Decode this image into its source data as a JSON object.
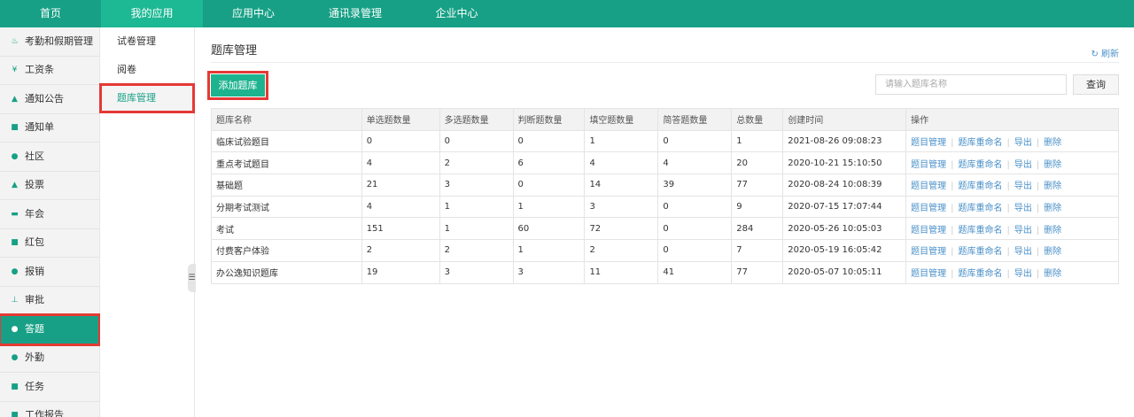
{
  "topnav": [
    {
      "label": "首页",
      "name": "nav-home",
      "active": false
    },
    {
      "label": "我的应用",
      "name": "nav-my-apps",
      "active": true
    },
    {
      "label": "应用中心",
      "name": "nav-app-center",
      "active": false
    },
    {
      "label": "通讯录管理",
      "name": "nav-contacts",
      "active": false
    },
    {
      "label": "企业中心",
      "name": "nav-enterprise",
      "active": false
    }
  ],
  "sidebar": [
    {
      "label": "考勤和假期管理",
      "icon": "attendance-icon",
      "glyph": "♨",
      "name": "sidebar-item-attendance"
    },
    {
      "label": "工资条",
      "icon": "salary-icon",
      "glyph": "¥",
      "name": "sidebar-item-salary"
    },
    {
      "label": "通知公告",
      "icon": "bell-icon",
      "glyph": "▲",
      "name": "sidebar-item-notice"
    },
    {
      "label": "通知单",
      "icon": "document-icon",
      "glyph": "■",
      "name": "sidebar-item-notice-form"
    },
    {
      "label": "社区",
      "icon": "chat-icon",
      "glyph": "●",
      "name": "sidebar-item-community"
    },
    {
      "label": "投票",
      "icon": "vote-icon",
      "glyph": "▲",
      "name": "sidebar-item-vote"
    },
    {
      "label": "年会",
      "icon": "ticket-icon",
      "glyph": "▬",
      "name": "sidebar-item-annual"
    },
    {
      "label": "红包",
      "icon": "red-packet-icon",
      "glyph": "■",
      "name": "sidebar-item-red-packet"
    },
    {
      "label": "报销",
      "icon": "reimburse-icon",
      "glyph": "●",
      "name": "sidebar-item-reimburse"
    },
    {
      "label": "审批",
      "icon": "approval-icon",
      "glyph": "⊥",
      "name": "sidebar-item-approval"
    },
    {
      "label": "答题",
      "icon": "quiz-icon",
      "glyph": "●",
      "name": "sidebar-item-quiz",
      "active": true
    },
    {
      "label": "外勤",
      "icon": "location-icon",
      "glyph": "●",
      "name": "sidebar-item-field"
    },
    {
      "label": "任务",
      "icon": "task-icon",
      "glyph": "■",
      "name": "sidebar-item-task"
    },
    {
      "label": "工作报告",
      "icon": "report-icon",
      "glyph": "■",
      "name": "sidebar-item-report"
    }
  ],
  "subnav": [
    {
      "label": "试卷管理",
      "name": "subnav-exam-papers"
    },
    {
      "label": "阅卷",
      "name": "subnav-grading"
    },
    {
      "label": "题库管理",
      "name": "subnav-question-bank",
      "active": true
    }
  ],
  "main": {
    "title": "题库管理",
    "refresh_label": "刷新",
    "add_label": "添加题库",
    "search_placeholder": "请输入题库名称",
    "search_value": "",
    "search_btn_label": "查询"
  },
  "table": {
    "headers": [
      "题库名称",
      "单选题数量",
      "多选题数量",
      "判断题数量",
      "填空题数量",
      "简答题数量",
      "总数量",
      "创建时间",
      "操作"
    ],
    "actions": [
      "题目管理",
      "题库重命名",
      "导出",
      "删除"
    ],
    "rows": [
      [
        "临床试验题目",
        "0",
        "0",
        "0",
        "1",
        "0",
        "1",
        "2021-08-26 09:08:23"
      ],
      [
        "重点考试题目",
        "4",
        "2",
        "6",
        "4",
        "4",
        "20",
        "2020-10-21 15:10:50"
      ],
      [
        "基础题",
        "21",
        "3",
        "0",
        "14",
        "39",
        "77",
        "2020-08-24 10:08:39"
      ],
      [
        "分期考试测试",
        "4",
        "1",
        "1",
        "3",
        "0",
        "9",
        "2020-07-15 17:07:44"
      ],
      [
        "考试",
        "151",
        "1",
        "60",
        "72",
        "0",
        "284",
        "2020-05-26 10:05:03"
      ],
      [
        "付费客户体验",
        "2",
        "2",
        "1",
        "2",
        "0",
        "7",
        "2020-05-19 16:05:42"
      ],
      [
        "办公逸知识题库",
        "19",
        "3",
        "3",
        "11",
        "41",
        "77",
        "2020-05-07 10:05:11"
      ]
    ]
  },
  "colors": {
    "primary": "#17a086",
    "highlight": "#e53935",
    "link": "#4a90c8"
  }
}
